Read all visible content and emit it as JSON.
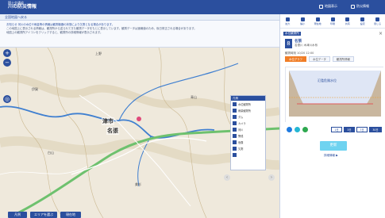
{
  "header": {
    "brand_top": "国土交通省",
    "title": "川の防災情報",
    "button_1": "地図表示",
    "button_2": "防災情報"
  },
  "topbar": {
    "button": "全国地図へ戻る"
  },
  "infobox": {
    "notice": "お知らせ 河川の水位や雨量等の情報は観測機器の状態により欠測となる場合があります。",
    "line_1": "この地図上に表示される情報は、観測所から送られてきた観測データをもとに表示しています。観測データは速報値のため、後日修正される場合があります。",
    "line_2": "地図上の観測所アイコンをクリックすると、観測所の詳細情報が表示されます。"
  },
  "map": {
    "city_label_1": "津市",
    "city_label_2": "名張",
    "small_labels": [
      "上野",
      "伊賀",
      "青山",
      "美杉",
      "白山"
    ],
    "legend_title": "凡例",
    "legend_items": [
      "水位観測所",
      "雨量観測所",
      "ダム",
      "カメラ",
      "河川",
      "警戒",
      "危険",
      "欠測"
    ],
    "bottom_buttons": [
      "凡例",
      "エリアを選ぶ",
      "現在地"
    ]
  },
  "panel": {
    "tools": [
      "拡大",
      "縮小",
      "現在地",
      "印刷",
      "共有",
      "設定",
      "閉じる"
    ],
    "tag": "水位観測所",
    "station_number": "8",
    "station_name": "名張",
    "station_sub": "名張川 木津川水系",
    "obs_time": "観測時刻 10/20 12:00",
    "tabs": [
      "水位グラフ",
      "水位データ",
      "観測所情報"
    ],
    "chart_label": "氾濫危険水位",
    "controls": [
      "1日",
      "3日",
      "7日",
      "30日"
    ],
    "big_button": "更新",
    "small_link": "詳細情報 ▶"
  }
}
